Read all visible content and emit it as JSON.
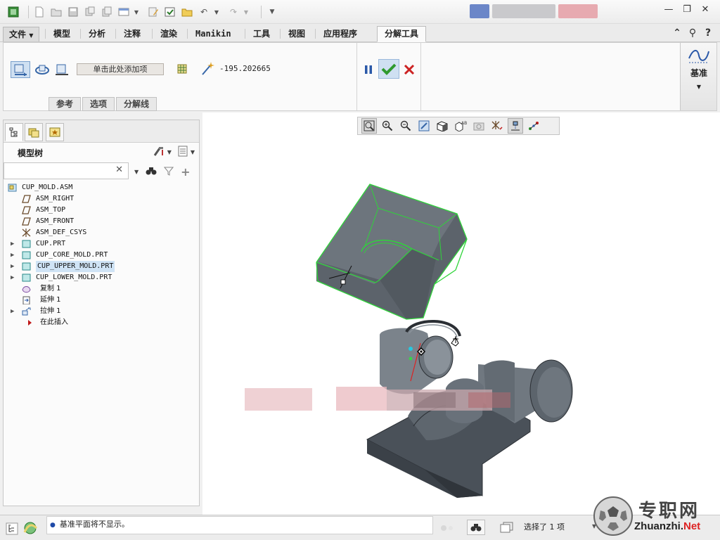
{
  "ribbon": {
    "file_tab": "文件",
    "tabs": [
      "模型",
      "分析",
      "注释",
      "渲染",
      "Manikin",
      "工具",
      "视图",
      "应用程序"
    ],
    "active_tab": "分解工具",
    "collector_text": "单击此处添加项",
    "distance_value": "-195.202665",
    "sub_tabs": [
      "参考",
      "选项",
      "分解线"
    ],
    "datum_label": "基准"
  },
  "model_tree": {
    "title": "模型树",
    "search_placeholder": "",
    "items": [
      {
        "label": "CUP_MOLD.ASM",
        "icon": "assembly-icon",
        "expandable": false,
        "selected": false
      },
      {
        "label": "ASM_RIGHT",
        "icon": "datum-plane-icon",
        "expandable": false,
        "selected": false
      },
      {
        "label": "ASM_TOP",
        "icon": "datum-plane-icon",
        "expandable": false,
        "selected": false
      },
      {
        "label": "ASM_FRONT",
        "icon": "datum-plane-icon",
        "expandable": false,
        "selected": false
      },
      {
        "label": "ASM_DEF_CSYS",
        "icon": "csys-icon",
        "expandable": false,
        "selected": false
      },
      {
        "label": "CUP.PRT",
        "icon": "part-icon",
        "expandable": true,
        "selected": false
      },
      {
        "label": "CUP_CORE_MOLD.PRT",
        "icon": "part-icon",
        "expandable": true,
        "selected": false
      },
      {
        "label": "CUP_UPPER_MOLD.PRT",
        "icon": "part-icon",
        "expandable": true,
        "selected": true
      },
      {
        "label": "CUP_LOWER_MOLD.PRT",
        "icon": "part-icon",
        "expandable": true,
        "selected": false
      },
      {
        "label": "复制 1",
        "icon": "copy-feature-icon",
        "expandable": false,
        "selected": false
      },
      {
        "label": "延伸 1",
        "icon": "extend-feature-icon",
        "expandable": false,
        "selected": false
      },
      {
        "label": "拉伸 1",
        "icon": "extrude-feature-icon",
        "expandable": true,
        "selected": false
      },
      {
        "label": "在此插入",
        "icon": "insert-here-icon",
        "expandable": false,
        "selected": false
      }
    ]
  },
  "status": {
    "message": "基准平面将不显示。",
    "selected": "选择了 1 项"
  },
  "watermark": {
    "cn": "专职网",
    "en_prefix": "Zhuanzhi.",
    "en_suffix": "Net"
  },
  "colors": {
    "ribbon_bg": "#fafafa",
    "selection_highlight": "#cfe3f5",
    "accept_green": "#2f9a2f",
    "cancel_red": "#cc2222",
    "mold_edge_green": "#2fd43a",
    "part_gray": "#5a6168"
  }
}
